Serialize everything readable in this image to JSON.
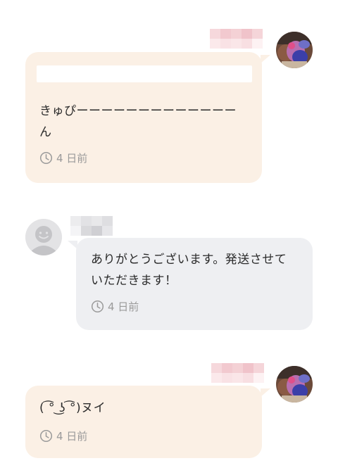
{
  "messages": [
    {
      "sender": "me",
      "text_line1": "きゅぴーーーーーーーーーーーーー",
      "text_line2": "ん",
      "time": "4 日前"
    },
    {
      "sender": "other",
      "text_line1": "ありがとうございます。発送させて",
      "text_line2": "いただきます！",
      "time": "4 日前"
    },
    {
      "sender": "me",
      "text_line1": "(   ͡° ͜ʖ ͡°)ヌイ",
      "time": "4 日前"
    }
  ],
  "icons": {
    "clock": "clock-icon",
    "default_avatar": "person-silhouette-icon"
  },
  "colors": {
    "my_bubble": "#fbf0e5",
    "their_bubble": "#eeeff2",
    "timestamp": "#9a9a9a",
    "blur_pink": "#f2c9cf",
    "blur_gray": "#d9d9dc"
  }
}
